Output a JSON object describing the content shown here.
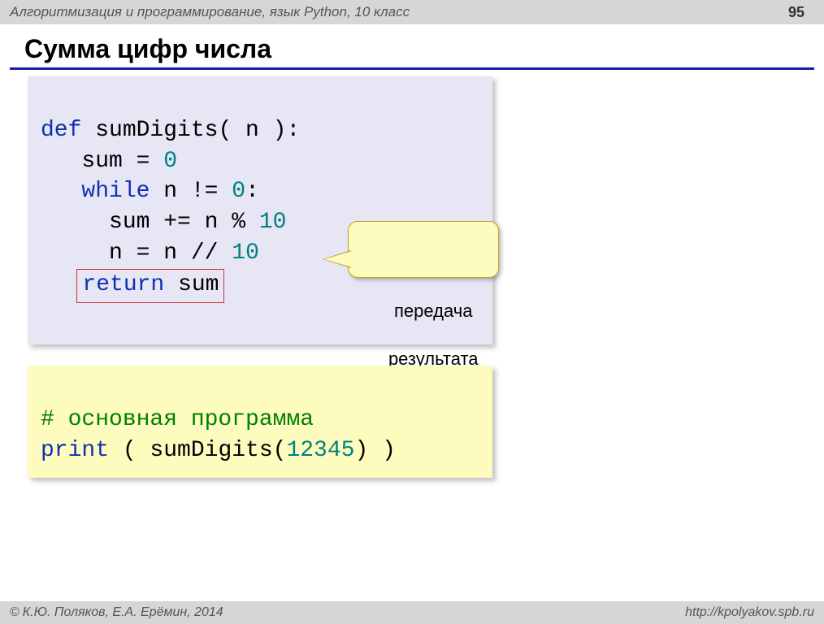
{
  "header": {
    "title": "Алгоритмизация и программирование, язык Python, 10 класс",
    "page": "95"
  },
  "title": "Сумма цифр числа",
  "code1": {
    "l1_kw": "def",
    "l1_name": " sumDigits( n ):",
    "l2_a": "   sum",
    "l2_eq": " = ",
    "l2_zero": "0",
    "l3_kw": "   while",
    "l3_a": " n",
    "l3_ne": " != ",
    "l3_zero": "0",
    "l3_colon": ":",
    "l4_a": "     sum",
    "l4_pe": " += ",
    "l4_b": "n % ",
    "l4_ten": "10",
    "l5_a": "     n",
    "l5_eq": " = ",
    "l5_b": "n // ",
    "l5_ten": "10",
    "l6_kw": "return",
    "l6_a": " sum"
  },
  "callout": {
    "line1": "передача",
    "line2": "результата"
  },
  "code2": {
    "l1_comment": "# основная программа",
    "l2_kw": "print",
    "l2_a": " ( sumDigits(",
    "l2_num": "12345",
    "l2_b": ") )"
  },
  "footer": {
    "left": "К.Ю. Поляков, Е.А. Ерёмин, 2014",
    "right": "http://kpolyakov.spb.ru"
  }
}
